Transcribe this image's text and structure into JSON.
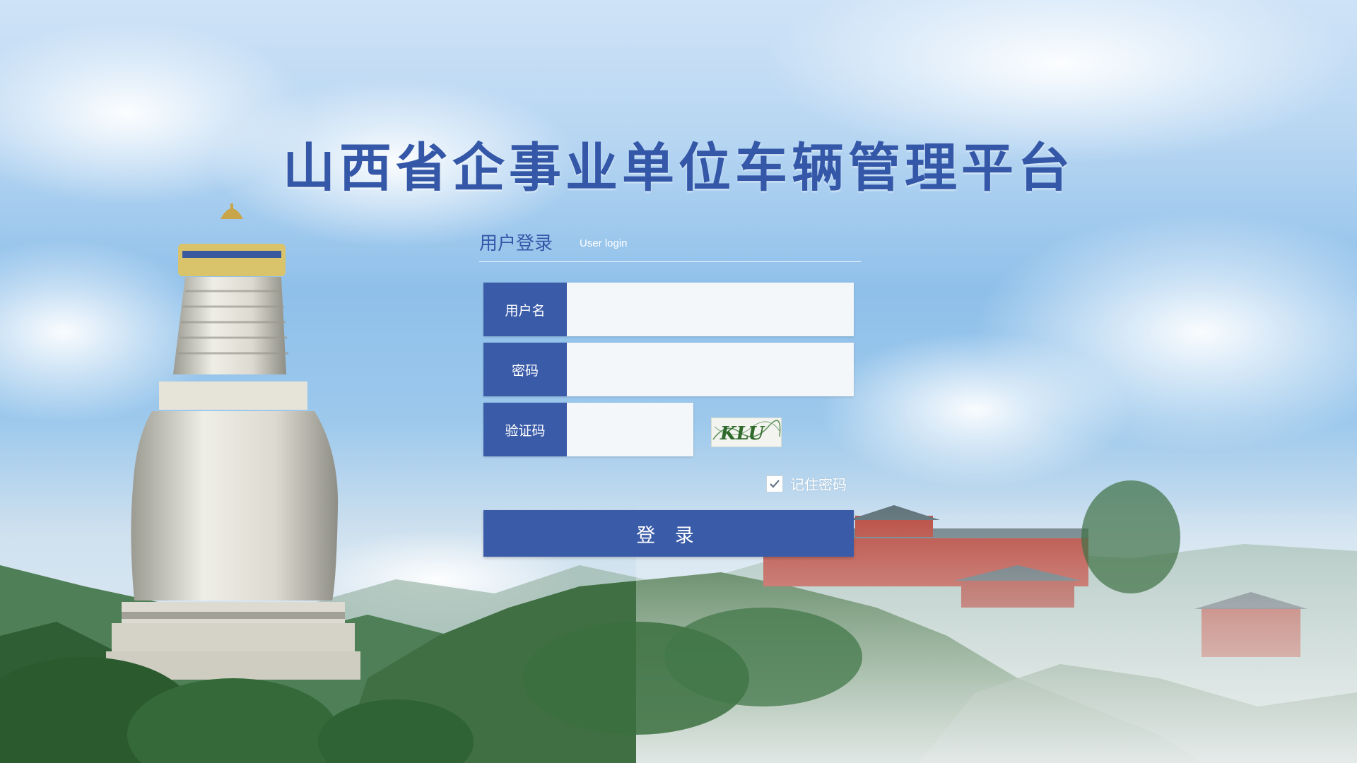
{
  "page": {
    "title": "山西省企事业单位车辆管理平台"
  },
  "login": {
    "heading": "用户登录",
    "subheading": "User login",
    "username": {
      "label": "用户名",
      "value": "",
      "placeholder": ""
    },
    "password": {
      "label": "密码",
      "value": "",
      "placeholder": ""
    },
    "captcha": {
      "label": "验证码",
      "value": "",
      "placeholder": "",
      "image_text": "KLU"
    },
    "remember": {
      "label": "记住密码",
      "checked": true
    },
    "submit_label": "登 录"
  },
  "colors": {
    "brand": "#3a5ba8",
    "title": "#3457a8",
    "input_bg": "#f4f7fa"
  },
  "icons": {
    "remember_check": "checkmark-icon"
  }
}
